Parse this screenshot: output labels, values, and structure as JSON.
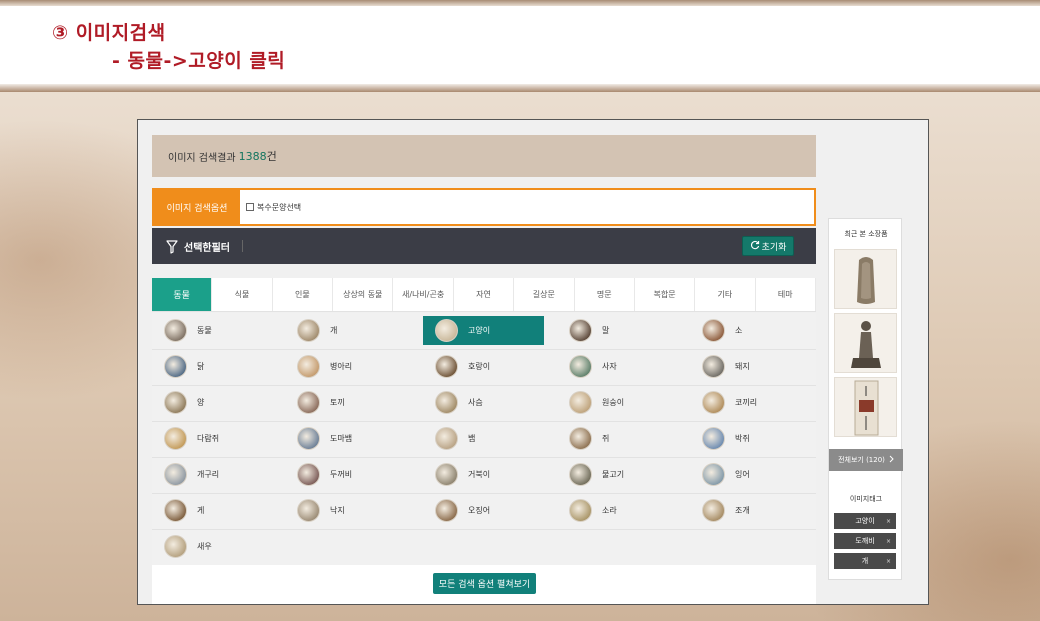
{
  "slide": {
    "heading": "③ 이미지검색",
    "subheading": "- 동물->고양이 클릭"
  },
  "results": {
    "label": "이미지 검색결과",
    "count": "1388",
    "unit": "건"
  },
  "options": {
    "label": "이미지 검색옵션",
    "multi_select_label": "복수문양선택",
    "multi_select_checked": false
  },
  "filter": {
    "label": "선택한필터",
    "reset_label": "초기화"
  },
  "tabs": [
    {
      "label": "동물",
      "active": true
    },
    {
      "label": "식물",
      "active": false
    },
    {
      "label": "인물",
      "active": false
    },
    {
      "label": "상상의 동물",
      "active": false
    },
    {
      "label": "새/나비/곤충",
      "active": false
    },
    {
      "label": "자연",
      "active": false
    },
    {
      "label": "길상문",
      "active": false
    },
    {
      "label": "명문",
      "active": false
    },
    {
      "label": "복합문",
      "active": false
    },
    {
      "label": "기타",
      "active": false
    },
    {
      "label": "테마",
      "active": false
    }
  ],
  "animals": [
    {
      "label": "동물",
      "selected": false,
      "color": "#7d6f62"
    },
    {
      "label": "개",
      "selected": false,
      "color": "#a08a6c"
    },
    {
      "label": "고양이",
      "selected": true,
      "color": "#c9b89a"
    },
    {
      "label": "말",
      "selected": false,
      "color": "#5a4638"
    },
    {
      "label": "소",
      "selected": false,
      "color": "#8d5b3c"
    },
    {
      "label": "닭",
      "selected": false,
      "color": "#506a86"
    },
    {
      "label": "병아리",
      "selected": false,
      "color": "#c49a6c"
    },
    {
      "label": "호랑이",
      "selected": false,
      "color": "#6e5236"
    },
    {
      "label": "사자",
      "selected": false,
      "color": "#5d7f6a"
    },
    {
      "label": "돼지",
      "selected": false,
      "color": "#6d6a64"
    },
    {
      "label": "양",
      "selected": false,
      "color": "#8e7a5a"
    },
    {
      "label": "토끼",
      "selected": false,
      "color": "#8a6a5a"
    },
    {
      "label": "사슴",
      "selected": false,
      "color": "#a08a66"
    },
    {
      "label": "원숭이",
      "selected": false,
      "color": "#bea27a"
    },
    {
      "label": "코끼리",
      "selected": false,
      "color": "#b08c5a"
    },
    {
      "label": "다람쥐",
      "selected": false,
      "color": "#c39a58"
    },
    {
      "label": "도마뱀",
      "selected": false,
      "color": "#6a7e96"
    },
    {
      "label": "뱀",
      "selected": false,
      "color": "#b8a284"
    },
    {
      "label": "쥐",
      "selected": false,
      "color": "#8d7050"
    },
    {
      "label": "박쥐",
      "selected": false,
      "color": "#6b8ab0"
    },
    {
      "label": "개구리",
      "selected": false,
      "color": "#8e98a2"
    },
    {
      "label": "두꺼비",
      "selected": false,
      "color": "#7a5a56"
    },
    {
      "label": "거북이",
      "selected": false,
      "color": "#8c826e"
    },
    {
      "label": "물고기",
      "selected": false,
      "color": "#6e6a58"
    },
    {
      "label": "잉어",
      "selected": false,
      "color": "#8098a8"
    },
    {
      "label": "게",
      "selected": false,
      "color": "#7c5c3c"
    },
    {
      "label": "낙지",
      "selected": false,
      "color": "#9a8a74"
    },
    {
      "label": "오징어",
      "selected": false,
      "color": "#8a6a4a"
    },
    {
      "label": "소라",
      "selected": false,
      "color": "#a89466"
    },
    {
      "label": "조개",
      "selected": false,
      "color": "#a58a62"
    },
    {
      "label": "새우",
      "selected": false,
      "color": "#b4a07e"
    }
  ],
  "expand_button": "모든 검색 옵션 펼쳐보기",
  "side": {
    "recent_title": "최근 본 소장품",
    "view_all": "전체보기 (120)",
    "tag_title": "이미지태그",
    "tags": [
      "고양이",
      "도깨비",
      "개"
    ],
    "tag_remove": "×"
  }
}
